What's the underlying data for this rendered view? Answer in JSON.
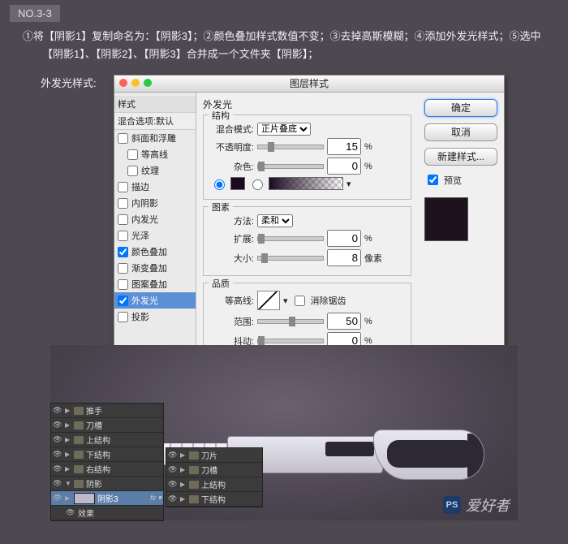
{
  "step_tag": "NO.3-3",
  "instructions_line1": "①将【阴影1】复制命名为：【阴影3】；②颜色叠加样式数值不变；③去掉高斯模糊；④添加外发光样式；⑤选中",
  "instructions_line2": "【阴影1】、【阴影2】、【阴影3】合并成一个文件夹【阴影】；",
  "glow_label": "外发光样式:",
  "dialog": {
    "title": "图层样式",
    "left_header1": "样式",
    "left_header2": "混合选项:默认",
    "styles": [
      {
        "label": "斜面和浮雕",
        "checked": false
      },
      {
        "label": "等高线",
        "checked": false,
        "indent": true
      },
      {
        "label": "纹理",
        "checked": false,
        "indent": true
      },
      {
        "label": "描边",
        "checked": false
      },
      {
        "label": "内阴影",
        "checked": false
      },
      {
        "label": "内发光",
        "checked": false
      },
      {
        "label": "光泽",
        "checked": false
      },
      {
        "label": "颜色叠加",
        "checked": true
      },
      {
        "label": "渐变叠加",
        "checked": false
      },
      {
        "label": "图案叠加",
        "checked": false
      },
      {
        "label": "外发光",
        "checked": true,
        "selected": true
      },
      {
        "label": "投影",
        "checked": false
      }
    ],
    "section_title": "外发光",
    "groups": {
      "structure": {
        "title": "结构",
        "blend_mode_label": "混合模式:",
        "blend_mode_value": "正片叠底",
        "opacity_label": "不透明度:",
        "opacity_value": "15",
        "opacity_unit": "%",
        "noise_label": "杂色:",
        "noise_value": "0",
        "noise_unit": "%"
      },
      "elements": {
        "title": "图素",
        "technique_label": "方法:",
        "technique_value": "柔和",
        "spread_label": "扩展:",
        "spread_value": "0",
        "spread_unit": "%",
        "size_label": "大小:",
        "size_value": "8",
        "size_unit": "像素"
      },
      "quality": {
        "title": "品质",
        "contour_label": "等高线:",
        "antialias_label": "消除锯齿",
        "range_label": "范围:",
        "range_value": "50",
        "range_unit": "%",
        "jitter_label": "抖动:",
        "jitter_value": "0",
        "jitter_unit": "%"
      }
    },
    "buttons": {
      "ok": "确定",
      "cancel": "取消",
      "new_style": "新建样式...",
      "preview": "预览"
    }
  },
  "layers_left": [
    {
      "type": "folder",
      "name": "推手"
    },
    {
      "type": "folder",
      "name": "刀槽"
    },
    {
      "type": "folder",
      "name": "上结构"
    },
    {
      "type": "folder",
      "name": "下结构"
    },
    {
      "type": "folder",
      "name": "右结构"
    },
    {
      "type": "folder",
      "name": "阴影",
      "open": true
    },
    {
      "type": "layer",
      "name": "阴影3",
      "selected": true,
      "fx": "fx"
    },
    {
      "type": "sub",
      "name": "效果"
    }
  ],
  "layers_right": [
    {
      "type": "folder",
      "name": "刀片"
    },
    {
      "type": "folder",
      "name": "刀槽"
    },
    {
      "type": "folder",
      "name": "上结构"
    },
    {
      "type": "folder",
      "name": "下结构"
    }
  ],
  "watermark": {
    "ps": "PS",
    "text": "爱好者"
  }
}
